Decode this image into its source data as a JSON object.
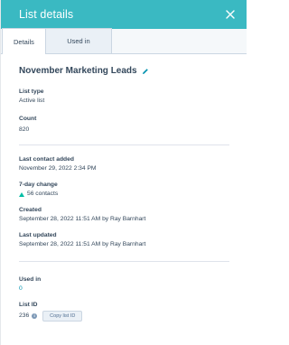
{
  "header": {
    "title": "List details",
    "close_icon": "close-icon"
  },
  "tabs": [
    {
      "label": "Details",
      "active": true
    },
    {
      "label": "Used in",
      "active": false
    }
  ],
  "list": {
    "name": "November Marketing Leads",
    "edit_icon": "pencil-icon"
  },
  "fields": {
    "list_type": {
      "label": "List type",
      "value": "Active list"
    },
    "count": {
      "label": "Count",
      "value": "820"
    },
    "last_contact_added": {
      "label": "Last contact added",
      "value": "November 29, 2022 2:34 PM"
    },
    "seven_day_change": {
      "label": "7-day change",
      "value": "56 contacts"
    },
    "created": {
      "label": "Created",
      "value": "September 28, 2022 11:51 AM by Ray Barnhart"
    },
    "last_updated": {
      "label": "Last updated",
      "value": "September 28, 2022 11:51 AM by Ray Barnhart"
    },
    "used_in": {
      "label": "Used in",
      "value": "0"
    },
    "list_id": {
      "label": "List ID",
      "value": "236",
      "copy_label": "Copy list ID"
    }
  },
  "colors": {
    "header_bg": "#3ab9c2",
    "accent_link": "#0091ae",
    "up_arrow": "#00bda5"
  }
}
